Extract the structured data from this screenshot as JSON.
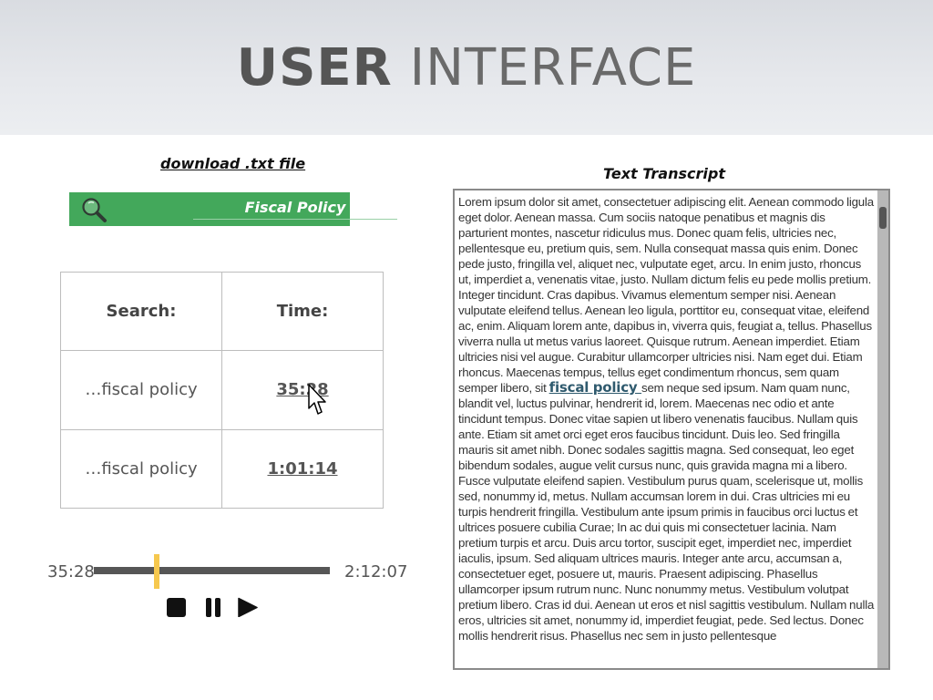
{
  "header": {
    "title_bold": "USER",
    "title_light": "INTERFACE"
  },
  "download": {
    "label": "download .txt file"
  },
  "search": {
    "value": "Fiscal Policy",
    "icon": "search-icon",
    "color": "#43a85b"
  },
  "results": {
    "headers": [
      "Search:",
      "Time:"
    ],
    "rows": [
      {
        "query": "…fiscal policy",
        "time": "35:28"
      },
      {
        "query": "…fiscal policy",
        "time": "1:01:14"
      }
    ]
  },
  "player": {
    "current_time": "35:28",
    "total_time": "2:12:07",
    "progress_fraction": 0.268,
    "handle_color": "#f6c84e",
    "controls": [
      "stop-icon",
      "pause-icon",
      "play-icon"
    ]
  },
  "transcript": {
    "title": "Text Transcript",
    "text_before": "Lorem ipsum dolor sit amet, consectetuer adipiscing elit. Aenean commodo ligula eget dolor. Aenean massa. Cum sociis natoque penatibus et magnis dis parturient montes, nascetur ridiculus mus. Donec quam felis, ultricies nec, pellentesque eu, pretium quis, sem. Nulla consequat massa quis enim. Donec pede justo, fringilla vel, aliquet nec, vulputate eget, arcu. In enim justo, rhoncus ut, imperdiet a, venenatis vitae, justo. Nullam dictum felis eu pede mollis pretium. Integer tincidunt. Cras dapibus. Vivamus elementum semper nisi. Aenean vulputate eleifend tellus. Aenean leo ligula, porttitor eu, consequat vitae, eleifend ac, enim. Aliquam lorem ante, dapibus in, viverra quis, feugiat a, tellus. Phasellus viverra nulla ut metus varius laoreet. Quisque rutrum. Aenean imperdiet. Etiam ultricies nisi vel augue. Curabitur ullamcorper ultricies nisi. Nam eget dui. Etiam rhoncus. Maecenas tempus, tellus eget condimentum rhoncus, sem quam semper libero, sit ",
    "highlight": "fiscal policy ",
    "text_after": "sem neque sed ipsum. Nam quam nunc, blandit vel, luctus pulvinar, hendrerit id, lorem. Maecenas nec odio et ante tincidunt tempus. Donec vitae sapien ut libero venenatis faucibus. Nullam quis ante. Etiam sit amet orci eget eros faucibus tincidunt. Duis leo. Sed fringilla mauris sit amet nibh. Donec sodales sagittis magna. Sed consequat, leo eget bibendum sodales, augue velit cursus nunc, quis gravida magna mi a libero. Fusce vulputate eleifend sapien. Vestibulum purus quam, scelerisque ut, mollis sed, nonummy id, metus. Nullam accumsan lorem in dui. Cras ultricies mi eu turpis hendrerit fringilla. Vestibulum ante ipsum primis in faucibus orci luctus et ultrices posuere cubilia Curae; In ac dui quis mi consectetuer lacinia. Nam pretium turpis et arcu. Duis arcu tortor, suscipit eget, imperdiet nec, imperdiet iaculis, ipsum. Sed aliquam ultrices mauris. Integer ante arcu, accumsan a, consectetuer eget, posuere ut, mauris. Praesent adipiscing. Phasellus ullamcorper ipsum rutrum nunc. Nunc nonummy metus. Vestibulum volutpat pretium libero. Cras id dui. Aenean ut eros et nisl sagittis vestibulum. Nullam nulla eros, ultricies sit amet, nonummy id, imperdiet feugiat, pede. Sed lectus. Donec mollis hendrerit risus. Phasellus nec sem in justo pellentesque"
  }
}
